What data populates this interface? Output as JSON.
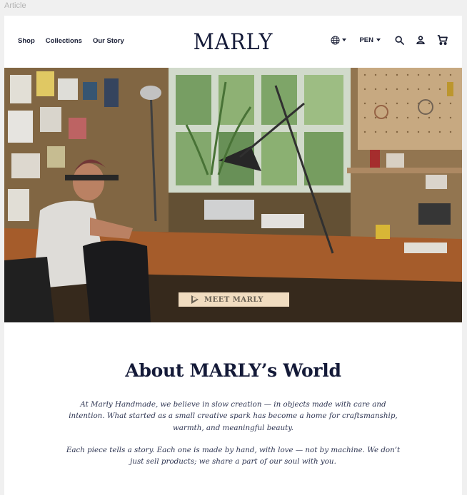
{
  "frame": {
    "label": "Article"
  },
  "header": {
    "nav": [
      {
        "label": "Shop"
      },
      {
        "label": "Collections"
      },
      {
        "label": "Our Story"
      }
    ],
    "logo": "MARLY",
    "currency": "PEN",
    "icons": [
      "globe-icon",
      "search-icon",
      "account-icon",
      "cart-icon"
    ]
  },
  "hero": {
    "button_label": "MEET MARLY",
    "button_icon": "play-icon"
  },
  "about": {
    "title": "About MARLY’s World",
    "paragraphs": [
      "At Marly Handmade, we believe in slow creation — in objects made with care and intention. What started as a small creative spark has become a home for craftsmanship, warmth, and meaningful beauty.",
      "Each piece tells a story. Each one is made by hand, with love — not by machine. We don’t just sell products; we share a part of our soul with you."
    ]
  },
  "colors": {
    "brand_navy": "#141a38",
    "button_bg": "#f1dcc0",
    "page_bg": "#f0f0f0"
  }
}
